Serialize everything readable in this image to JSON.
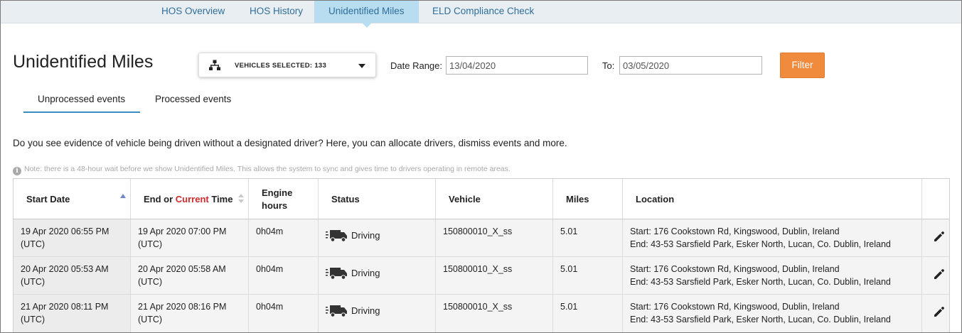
{
  "nav": {
    "tabs": [
      {
        "label": "HOS Overview",
        "active": false
      },
      {
        "label": "HOS History",
        "active": false
      },
      {
        "label": "Unidentified Miles",
        "active": true
      },
      {
        "label": "ELD Compliance Check",
        "active": false
      }
    ]
  },
  "page": {
    "title": "Unidentified Miles"
  },
  "filters": {
    "vehicles_label": "VEHICLES SELECTED: 133",
    "vehicles_icon": "hierarchy-icon",
    "date_range_label": "Date Range:",
    "date_from": "13/04/2020",
    "to_label": "To:",
    "date_to": "03/05/2020",
    "filter_button": "Filter",
    "accent_color": "#f08a3c"
  },
  "subtabs": [
    {
      "label": "Unprocessed events",
      "active": true
    },
    {
      "label": "Processed events",
      "active": false
    }
  ],
  "intro_text": "Do you see evidence of vehicle being driven without a designated driver? Here, you can allocate drivers, dismiss events and more.",
  "note_text": "Note: there is a 48-hour wait before we show Unidentified Miles. This allows the system to sync and gives time to drivers operating in remote areas.",
  "table": {
    "headers": {
      "start_date": "Start Date",
      "end_prefix": "End or ",
      "end_current": "Current",
      "end_suffix": " Time",
      "engine_line1": "Engine",
      "engine_line2": "hours",
      "status": "Status",
      "vehicle": "Vehicle",
      "miles": "Miles",
      "location": "Location"
    },
    "rows": [
      {
        "start_line1": "19 Apr 2020 06:55 PM",
        "start_line2": "(UTC)",
        "end_line1": "19 Apr 2020 07:00 PM",
        "end_line2": "(UTC)",
        "engine_hours": "0h04m",
        "status": "Driving",
        "vehicle": "150800010_X_ss",
        "miles": "5.01",
        "location_start": "Start: 176 Cookstown Rd, Kingswood, Dublin, Ireland",
        "location_end": "End: 43-53 Sarsfield Park, Esker North, Lucan, Co. Dublin, Ireland"
      },
      {
        "start_line1": "20 Apr 2020 05:53 AM",
        "start_line2": "(UTC)",
        "end_line1": "20 Apr 2020 05:58 AM",
        "end_line2": "(UTC)",
        "engine_hours": "0h04m",
        "status": "Driving",
        "vehicle": "150800010_X_ss",
        "miles": "5.01",
        "location_start": "Start: 176 Cookstown Rd, Kingswood, Dublin, Ireland",
        "location_end": "End: 43-53 Sarsfield Park, Esker North, Lucan, Co. Dublin, Ireland"
      },
      {
        "start_line1": "21 Apr 2020 08:11 PM",
        "start_line2": "(UTC)",
        "end_line1": "21 Apr 2020 08:16 PM",
        "end_line2": "(UTC)",
        "engine_hours": "0h04m",
        "status": "Driving",
        "vehicle": "150800010_X_ss",
        "miles": "5.01",
        "location_start": "Start: 176 Cookstown Rd, Kingswood, Dublin, Ireland",
        "location_end": "End: 43-53 Sarsfield Park, Esker North, Lucan, Co. Dublin, Ireland"
      }
    ]
  }
}
